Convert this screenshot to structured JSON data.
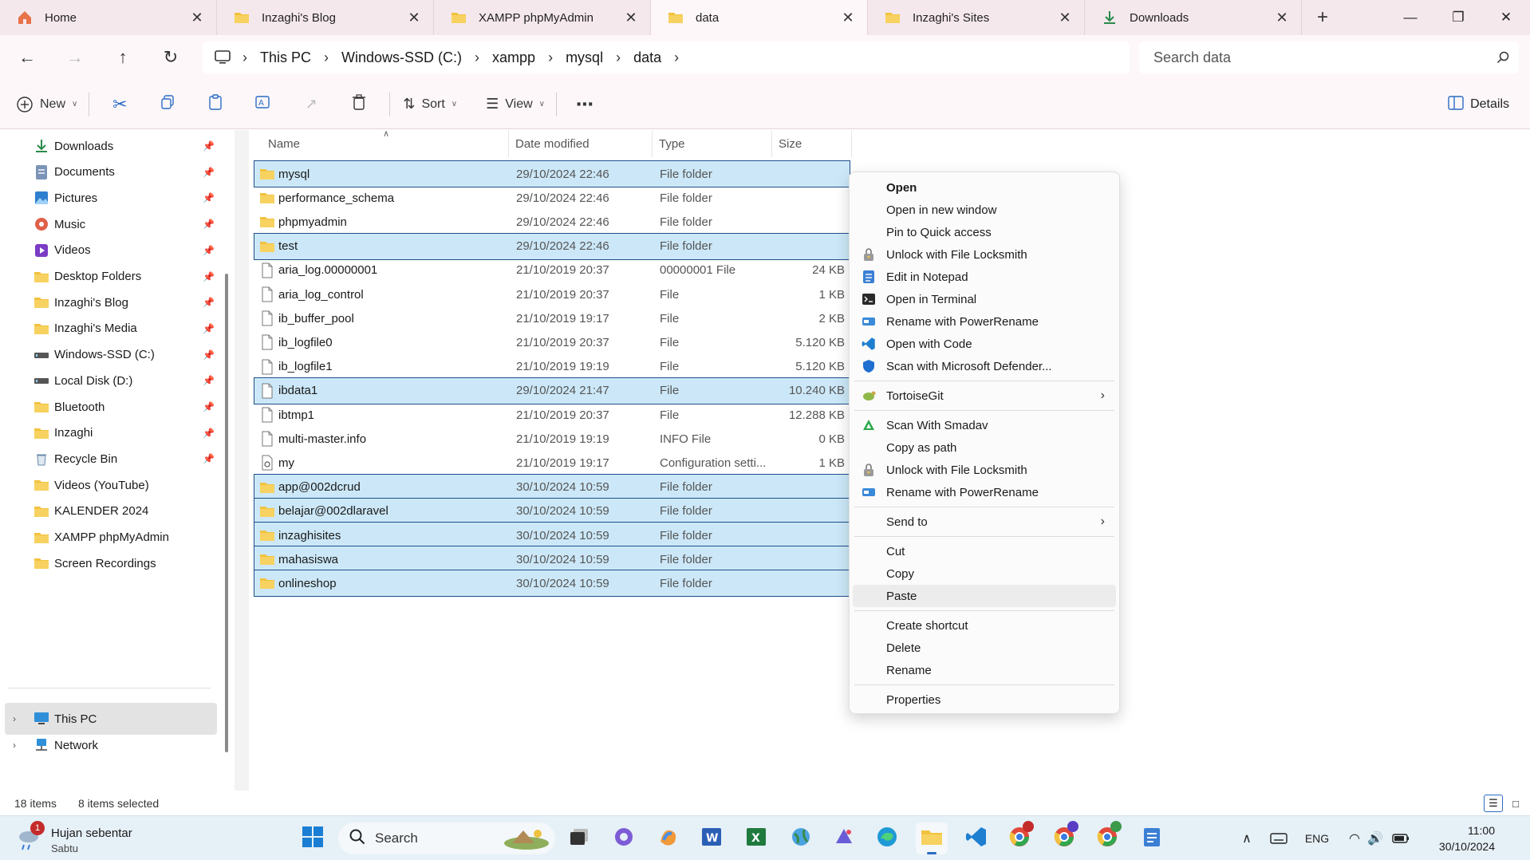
{
  "tabs": [
    {
      "label": "Home",
      "icon": "home-icon",
      "active": false
    },
    {
      "label": "Inzaghi's Blog",
      "icon": "folder-icon",
      "active": false
    },
    {
      "label": "XAMPP phpMyAdmin",
      "icon": "folder-icon",
      "active": false
    },
    {
      "label": "data",
      "icon": "folder-icon",
      "active": true
    },
    {
      "label": "Inzaghi's Sites",
      "icon": "folder-icon",
      "active": false
    },
    {
      "label": "Downloads",
      "icon": "download-icon",
      "active": false
    }
  ],
  "breadcrumb": [
    "This PC",
    "Windows-SSD (C:)",
    "xampp",
    "mysql",
    "data"
  ],
  "search": {
    "placeholder": "Search data"
  },
  "toolbar": {
    "new_label": "New",
    "sort_label": "Sort",
    "view_label": "View",
    "details_label": "Details"
  },
  "sidebar": {
    "items": [
      {
        "label": "Downloads",
        "icon": "download-icon",
        "pinned": true
      },
      {
        "label": "Documents",
        "icon": "documents-icon",
        "pinned": true
      },
      {
        "label": "Pictures",
        "icon": "pictures-icon",
        "pinned": true
      },
      {
        "label": "Music",
        "icon": "music-icon",
        "pinned": true
      },
      {
        "label": "Videos",
        "icon": "videos-icon",
        "pinned": true
      },
      {
        "label": "Desktop Folders",
        "icon": "folder-icon",
        "pinned": true
      },
      {
        "label": "Inzaghi's Blog",
        "icon": "folder-icon",
        "pinned": true
      },
      {
        "label": "Inzaghi's Media",
        "icon": "folder-icon",
        "pinned": true
      },
      {
        "label": "Windows-SSD (C:)",
        "icon": "drive-icon",
        "pinned": true
      },
      {
        "label": "Local Disk (D:)",
        "icon": "drive-icon",
        "pinned": true
      },
      {
        "label": "Bluetooth",
        "icon": "folder-icon",
        "pinned": true
      },
      {
        "label": "Inzaghi",
        "icon": "folder-icon",
        "pinned": true
      },
      {
        "label": "Recycle Bin",
        "icon": "recycle-bin-icon",
        "pinned": true
      },
      {
        "label": "Videos (YouTube)",
        "icon": "folder-icon",
        "pinned": false
      },
      {
        "label": "KALENDER 2024",
        "icon": "folder-icon",
        "pinned": false
      },
      {
        "label": "XAMPP phpMyAdmin",
        "icon": "folder-icon",
        "pinned": false
      },
      {
        "label": "Screen Recordings",
        "icon": "folder-icon",
        "pinned": false
      }
    ],
    "tree": [
      {
        "label": "This PC",
        "icon": "computer-icon",
        "selected": true
      },
      {
        "label": "Network",
        "icon": "network-icon",
        "selected": false
      }
    ]
  },
  "columns": {
    "name": "Name",
    "date": "Date modified",
    "type": "Type",
    "size": "Size"
  },
  "files": [
    {
      "name": "mysql",
      "date": "29/10/2024 22:46",
      "type": "File folder",
      "size": "",
      "folder": true,
      "selected": true
    },
    {
      "name": "performance_schema",
      "date": "29/10/2024 22:46",
      "type": "File folder",
      "size": "",
      "folder": true,
      "selected": false
    },
    {
      "name": "phpmyadmin",
      "date": "29/10/2024 22:46",
      "type": "File folder",
      "size": "",
      "folder": true,
      "selected": false
    },
    {
      "name": "test",
      "date": "29/10/2024 22:46",
      "type": "File folder",
      "size": "",
      "folder": true,
      "selected": true
    },
    {
      "name": "aria_log.00000001",
      "date": "21/10/2019 20:37",
      "type": "00000001 File",
      "size": "24 KB",
      "folder": false,
      "selected": false
    },
    {
      "name": "aria_log_control",
      "date": "21/10/2019 20:37",
      "type": "File",
      "size": "1 KB",
      "folder": false,
      "selected": false
    },
    {
      "name": "ib_buffer_pool",
      "date": "21/10/2019 19:17",
      "type": "File",
      "size": "2 KB",
      "folder": false,
      "selected": false
    },
    {
      "name": "ib_logfile0",
      "date": "21/10/2019 20:37",
      "type": "File",
      "size": "5.120 KB",
      "folder": false,
      "selected": false
    },
    {
      "name": "ib_logfile1",
      "date": "21/10/2019 19:19",
      "type": "File",
      "size": "5.120 KB",
      "folder": false,
      "selected": false
    },
    {
      "name": "ibdata1",
      "date": "29/10/2024 21:47",
      "type": "File",
      "size": "10.240 KB",
      "folder": false,
      "selected": true
    },
    {
      "name": "ibtmp1",
      "date": "21/10/2019 20:37",
      "type": "File",
      "size": "12.288 KB",
      "folder": false,
      "selected": false
    },
    {
      "name": "multi-master.info",
      "date": "21/10/2019 19:19",
      "type": "INFO File",
      "size": "0 KB",
      "folder": false,
      "selected": false
    },
    {
      "name": "my",
      "date": "21/10/2019 19:17",
      "type": "Configuration setti...",
      "size": "1 KB",
      "folder": false,
      "selected": false
    },
    {
      "name": "app@002dcrud",
      "date": "30/10/2024 10:59",
      "type": "File folder",
      "size": "",
      "folder": true,
      "selected": true
    },
    {
      "name": "belajar@002dlaravel",
      "date": "30/10/2024 10:59",
      "type": "File folder",
      "size": "",
      "folder": true,
      "selected": true
    },
    {
      "name": "inzaghisites",
      "date": "30/10/2024 10:59",
      "type": "File folder",
      "size": "",
      "folder": true,
      "selected": true
    },
    {
      "name": "mahasiswa",
      "date": "30/10/2024 10:59",
      "type": "File folder",
      "size": "",
      "folder": true,
      "selected": true
    },
    {
      "name": "onlineshop",
      "date": "30/10/2024 10:59",
      "type": "File folder",
      "size": "",
      "folder": true,
      "selected": true
    }
  ],
  "context_menu": {
    "group1": [
      {
        "label": "Open",
        "icon": "",
        "bold": true
      },
      {
        "label": "Open in new window",
        "icon": ""
      },
      {
        "label": "Pin to Quick access",
        "icon": ""
      },
      {
        "label": "Unlock with File Locksmith",
        "icon": "lock-icon"
      },
      {
        "label": "Edit in Notepad",
        "icon": "notepad-icon"
      },
      {
        "label": "Open in Terminal",
        "icon": "terminal-icon"
      },
      {
        "label": "Rename with PowerRename",
        "icon": "powerrename-icon"
      },
      {
        "label": "Open with Code",
        "icon": "vscode-icon"
      },
      {
        "label": "Scan with Microsoft Defender...",
        "icon": "defender-icon"
      }
    ],
    "group2": [
      {
        "label": "TortoiseGit",
        "icon": "tortoisegit-icon",
        "submenu": true
      }
    ],
    "group3": [
      {
        "label": "Scan With Smadav",
        "icon": "smadav-icon"
      },
      {
        "label": "Copy as path",
        "icon": ""
      },
      {
        "label": "Unlock with File Locksmith",
        "icon": "lock-icon"
      },
      {
        "label": "Rename with PowerRename",
        "icon": "powerrename-icon"
      }
    ],
    "group4": [
      {
        "label": "Send to",
        "icon": "",
        "submenu": true
      }
    ],
    "group5": [
      {
        "label": "Cut",
        "icon": ""
      },
      {
        "label": "Copy",
        "icon": ""
      },
      {
        "label": "Paste",
        "icon": "",
        "hover": true
      }
    ],
    "group6": [
      {
        "label": "Create shortcut",
        "icon": ""
      },
      {
        "label": "Delete",
        "icon": ""
      },
      {
        "label": "Rename",
        "icon": ""
      }
    ],
    "group7": [
      {
        "label": "Properties",
        "icon": ""
      }
    ]
  },
  "status": {
    "count": "18 items",
    "selected": "8 items selected"
  },
  "taskbar": {
    "weather_title": "Hujan sebentar",
    "weather_sub": "Sabtu",
    "weather_badge": "1",
    "search_label": "Search",
    "lang": "ENG",
    "time": "11:00",
    "date": "30/10/2024"
  },
  "colors": {
    "selection_bg": "#cce8f8",
    "selection_border": "#1e4f8a",
    "tab_bar": "#f5e8ec",
    "folder": "#f2c23f",
    "accent": "#2b6cc4"
  }
}
